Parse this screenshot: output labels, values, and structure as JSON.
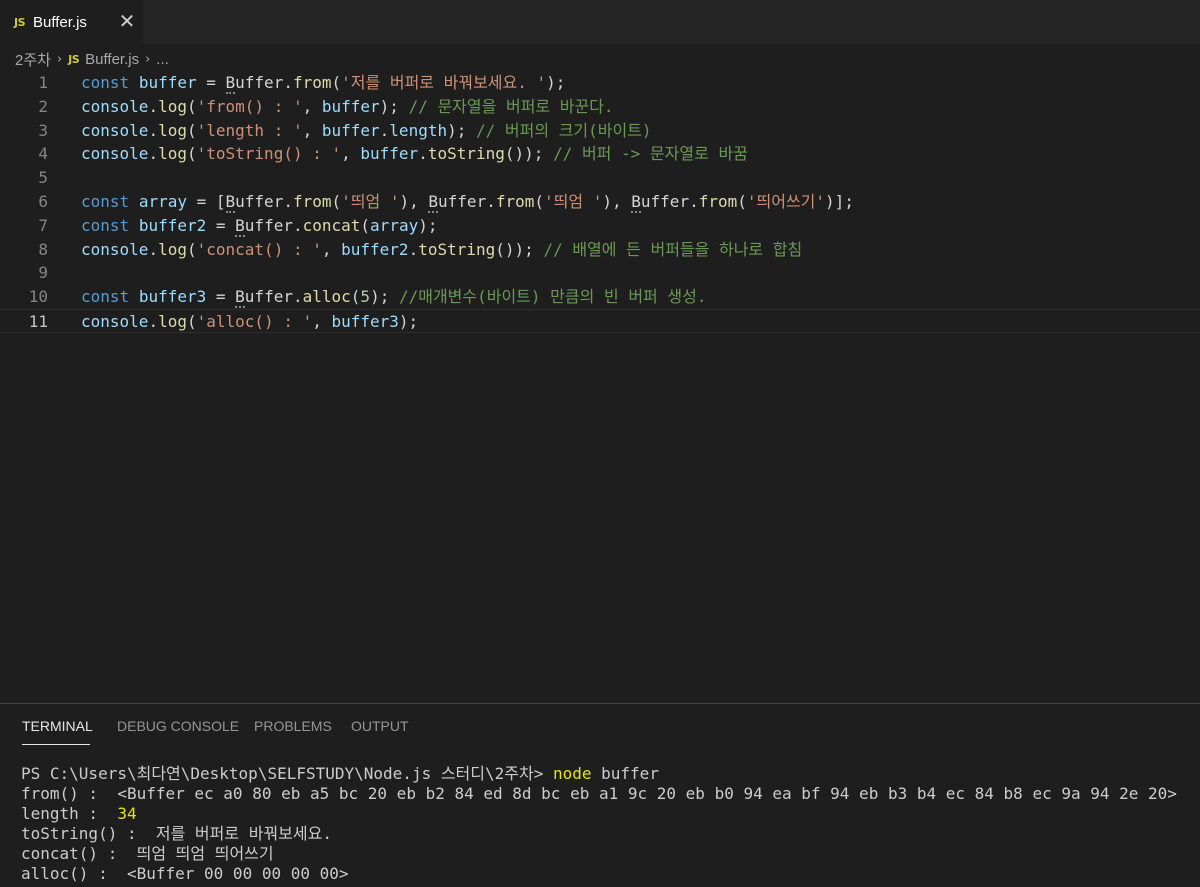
{
  "tab": {
    "badge": "JS",
    "label": "Buffer.js",
    "close": "✕"
  },
  "breadcrumb": {
    "folder": "2주차",
    "sep": "›",
    "badge": "JS",
    "file": "Buffer.js",
    "more": "..."
  },
  "editor": {
    "line_numbers": [
      "1",
      "2",
      "3",
      "4",
      "5",
      "6",
      "7",
      "8",
      "9",
      "10",
      "11"
    ],
    "current_line": 11
  },
  "panel": {
    "tabs": [
      "TERMINAL",
      "DEBUG CONSOLE",
      "PROBLEMS",
      "OUTPUT"
    ],
    "active_tab": "TERMINAL"
  },
  "terminal": {
    "prompt": "PS C:\\Users\\최다연\\Desktop\\SELFSTUDY\\Node.js 스터디\\2주차> ",
    "command_name": "node",
    "command_arg": " buffer",
    "from_label": "from() :  ",
    "from_value": "<Buffer ec a0 80 eb a5 bc 20 eb b2 84 ed 8d bc eb a1 9c 20 eb b0 94 ea bf 94 eb b3 b4 ec 84 b8 ec 9a 94 2e 20>",
    "length_label": "length :  ",
    "length_value": "34",
    "tostring_label": "toString() :  ",
    "tostring_value": "저를 버퍼로 바꿔보세요.",
    "concat_label": "concat() :  ",
    "concat_value": "띄엄 띄엄 띄어쓰기",
    "alloc_label": "alloc() :  ",
    "alloc_value": "<Buffer 00 00 00 00 00>"
  },
  "colors": {
    "keyword": "#569cd6",
    "variable": "#9cdcfe",
    "function": "#dcdcaa",
    "string": "#ce9178",
    "comment": "#6a9955",
    "number": "#b5cea8"
  }
}
